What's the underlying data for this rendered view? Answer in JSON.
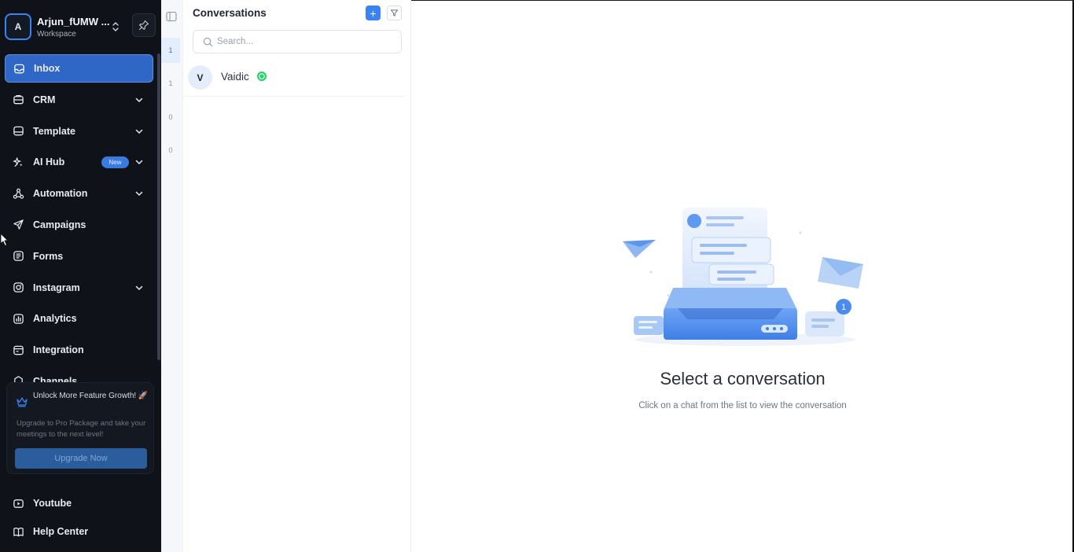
{
  "workspace": {
    "avatar_letter": "A",
    "name": "Arjun_fUMW ...",
    "subtitle": "Workspace"
  },
  "sidebar": {
    "items": [
      {
        "label": "Inbox",
        "icon": "inbox-icon",
        "active": true,
        "expandable": false
      },
      {
        "label": "CRM",
        "icon": "crm-icon",
        "expandable": true
      },
      {
        "label": "Template",
        "icon": "template-icon",
        "expandable": true
      },
      {
        "label": "AI Hub",
        "icon": "sparkle-icon",
        "expandable": true,
        "badge": "New"
      },
      {
        "label": "Automation",
        "icon": "automation-icon",
        "expandable": true
      },
      {
        "label": "Campaigns",
        "icon": "send-icon",
        "expandable": false
      },
      {
        "label": "Forms",
        "icon": "forms-icon",
        "expandable": false
      },
      {
        "label": "Instagram",
        "icon": "instagram-icon",
        "expandable": true
      },
      {
        "label": "Analytics",
        "icon": "analytics-icon",
        "expandable": false
      },
      {
        "label": "Integration",
        "icon": "integration-icon",
        "expandable": false
      },
      {
        "label": "Channels",
        "icon": "channels-icon",
        "expandable": false
      }
    ],
    "promo": {
      "title": "Unlock More Feature Growth! 🚀",
      "text": "Upgrade to Pro Package and take your meetings to the next level!",
      "button": "Upgrade Now"
    },
    "footer": [
      {
        "label": "Youtube",
        "icon": "youtube-icon"
      },
      {
        "label": "Help Center",
        "icon": "book-icon"
      }
    ]
  },
  "counts": [
    "1",
    "1",
    "0",
    "0"
  ],
  "conversations": {
    "title": "Conversations",
    "add_label": "+",
    "search_placeholder": "Search...",
    "items": [
      {
        "avatar": "V",
        "name": "Vaidic",
        "channel": "whatsapp-icon"
      }
    ]
  },
  "empty_state": {
    "title": "Select a conversation",
    "subtitle": "Click on a chat from the list to view the conversation",
    "notification_count": "1"
  },
  "colors": {
    "sidebar_bg": "#0f1319",
    "accent": "#3b82f6",
    "active_item": "#2f67c7",
    "whatsapp": "#25d366"
  }
}
